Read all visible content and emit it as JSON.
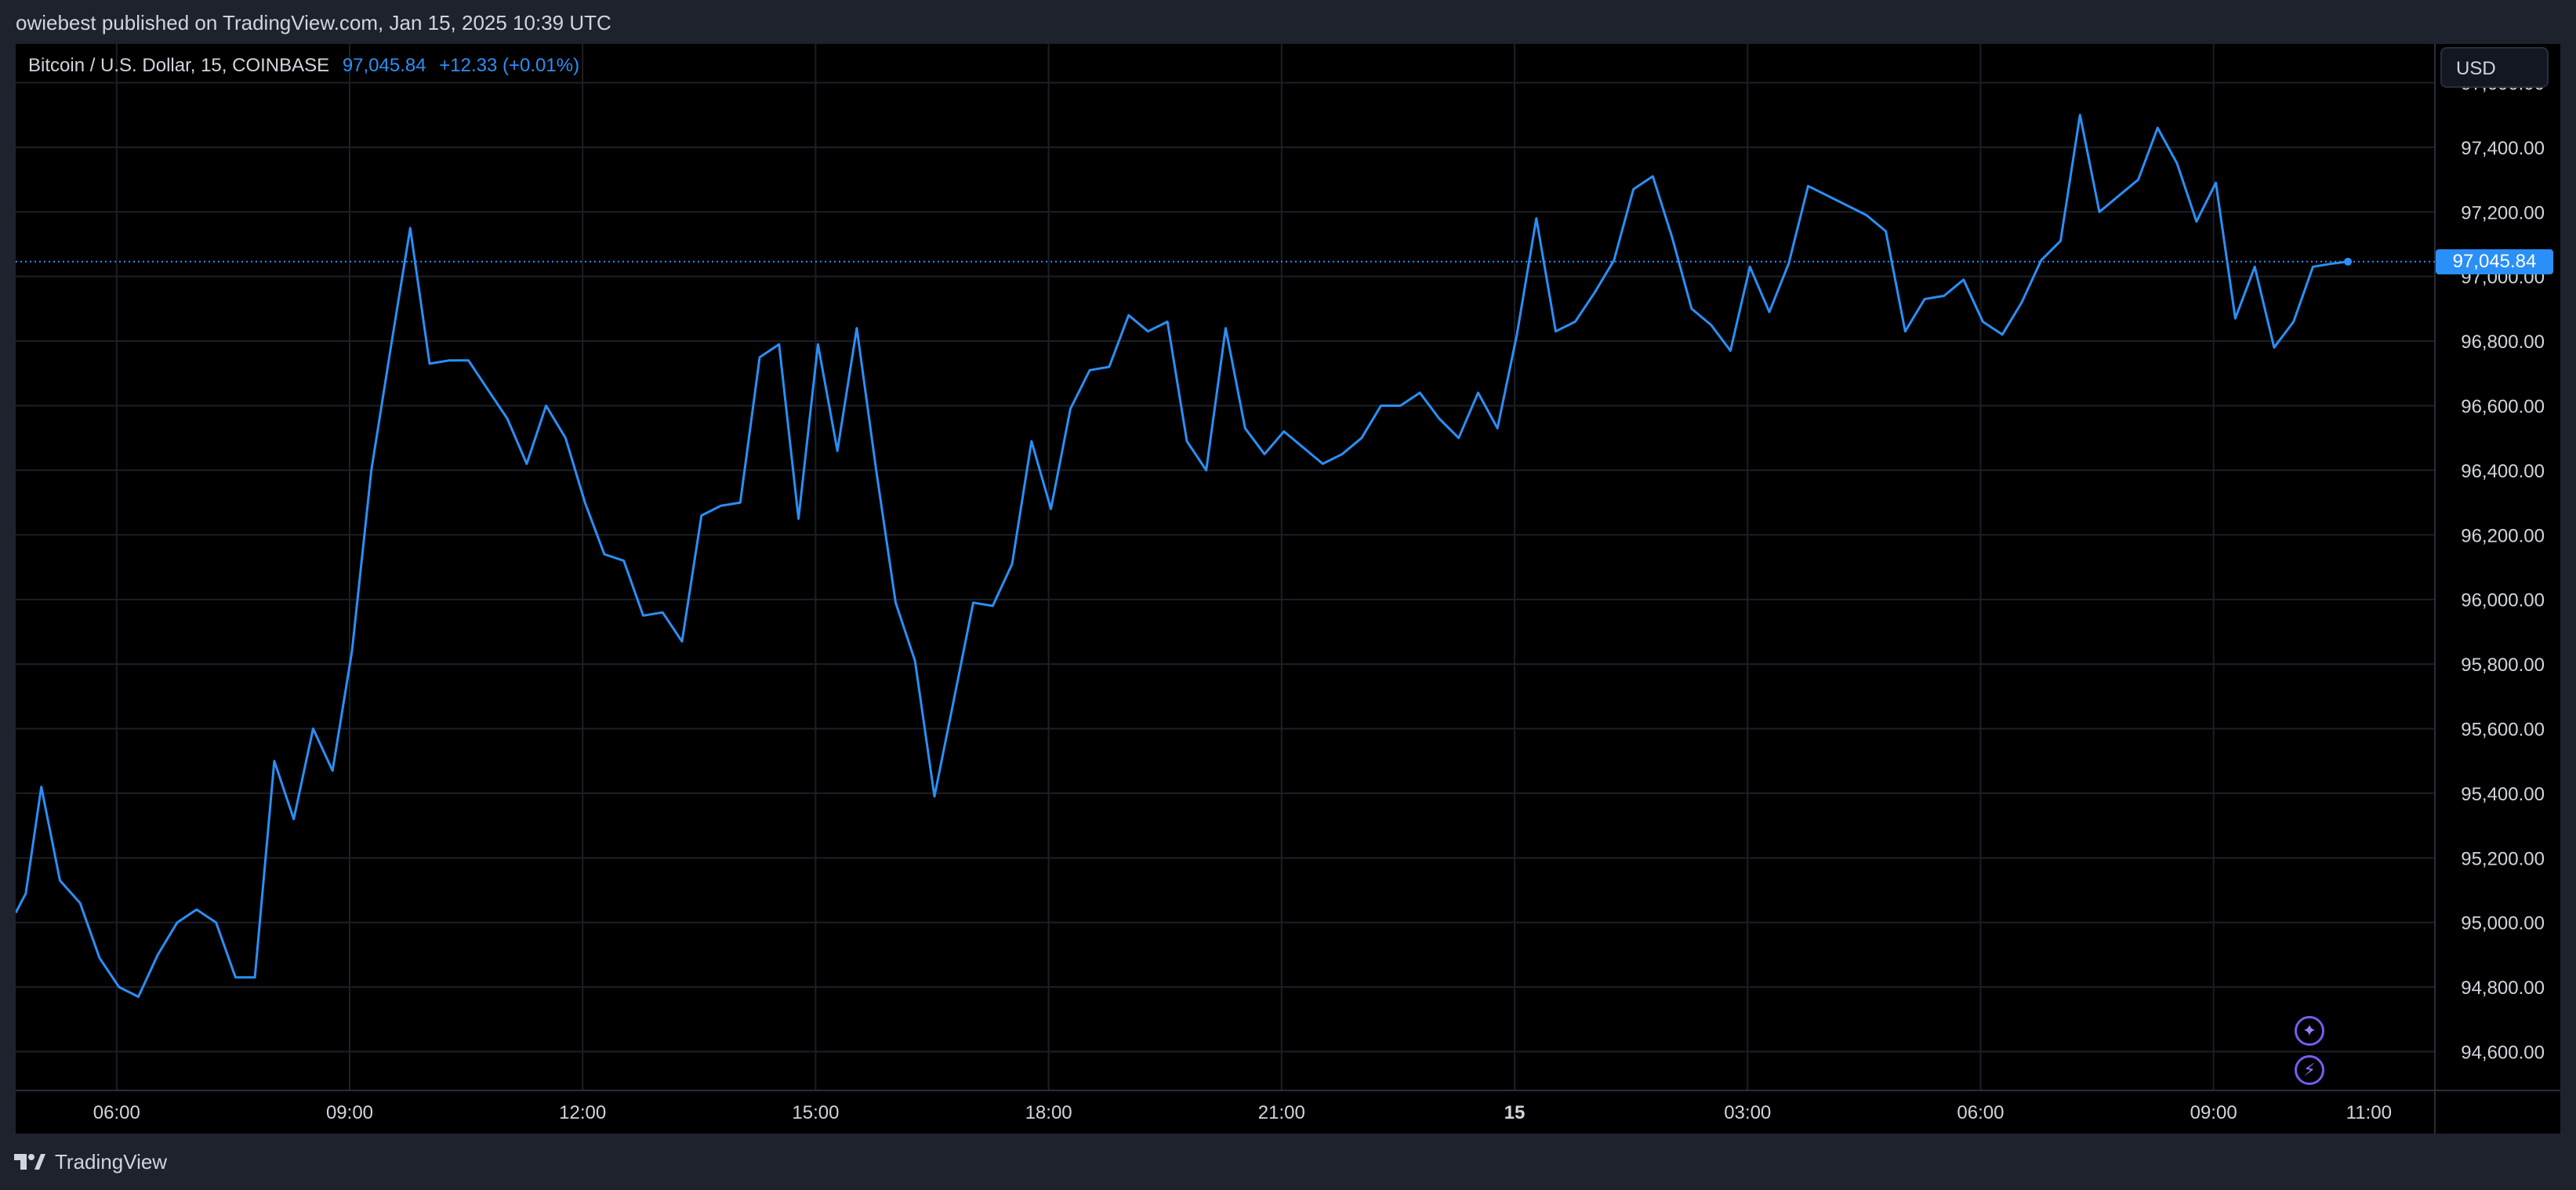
{
  "header": {
    "publisher_text": "owiebest published on TradingView.com, Jan 15, 2025 10:39 UTC"
  },
  "legend": {
    "symbol": "Bitcoin / U.S. Dollar, 15, COINBASE",
    "price": "97,045.84",
    "change": "+12.33 (+0.01%)"
  },
  "currency_button": {
    "label": "USD"
  },
  "last_price_badge": "97,045.84",
  "footer": {
    "logo_text": "TradingView"
  },
  "colors": {
    "line": "#2a8ff7",
    "background": "#000000",
    "grid": "#1c1f26",
    "axis_text": "#d1d4dc",
    "badge": "#2a8ff7"
  },
  "icons": {
    "spark": "sparkle-icon",
    "lightning": "lightning-icon",
    "logo": "tradingview-logo-icon"
  },
  "chart_data": {
    "type": "line",
    "ylim": [
      94480,
      97720
    ],
    "y_ticks": [
      94600,
      94800,
      95000,
      95200,
      95400,
      95600,
      95800,
      96000,
      96200,
      96400,
      96600,
      96800,
      97000,
      97200,
      97400,
      97600
    ],
    "y_tick_labels": [
      "94,600.00",
      "94,800.00",
      "95,000.00",
      "95,200.00",
      "95,400.00",
      "95,600.00",
      "95,800.00",
      "96,000.00",
      "96,200.00",
      "96,400.00",
      "96,600.00",
      "96,800.00",
      "97,000.00",
      "97,200.00",
      "97,400.00",
      "97,600.00"
    ],
    "x_tick_labels": [
      "06:00",
      "09:00",
      "12:00",
      "15:00",
      "18:00",
      "21:00",
      "15",
      "03:00",
      "06:00",
      "09:00",
      "11:00"
    ],
    "x_tick_hours": [
      6,
      9,
      12,
      15,
      18,
      21,
      24,
      27,
      30,
      33,
      35
    ],
    "x_range_hours": [
      4.7,
      35.85
    ],
    "last_value": 97045.84,
    "series": [
      {
        "hours": [
          4.7,
          4.83,
          5.03,
          5.27,
          5.53,
          5.78,
          6.03,
          6.28,
          6.53,
          6.78,
          7.03,
          7.28,
          7.53,
          7.78,
          8.03,
          8.28,
          8.53,
          8.78,
          9.03,
          9.28,
          9.53,
          9.78,
          10.03,
          10.28,
          10.53,
          10.78,
          11.03,
          11.28,
          11.53,
          11.78,
          12.03,
          12.28,
          12.53,
          12.78,
          13.03,
          13.28,
          13.53,
          13.78,
          14.03,
          14.28,
          14.53,
          14.78,
          15.03,
          15.28,
          15.53,
          15.78,
          16.03,
          16.28,
          16.53,
          16.78,
          17.03,
          17.28,
          17.53,
          17.78,
          18.03,
          18.28,
          18.53,
          18.78,
          19.03,
          19.28,
          19.53,
          19.78,
          20.03,
          20.28,
          20.53,
          20.78,
          21.03,
          21.28,
          21.53,
          21.78,
          22.03,
          22.28,
          22.53,
          22.78,
          23.03,
          23.28,
          23.53,
          23.78,
          24.03,
          24.28,
          24.53,
          24.78,
          25.03,
          25.28,
          25.53,
          25.78,
          26.03,
          26.28,
          26.53,
          26.78,
          27.03,
          27.28,
          27.53,
          27.78,
          28.03,
          28.28,
          28.53,
          28.78,
          29.03,
          29.28,
          29.53,
          29.78,
          30.03,
          30.28,
          30.53,
          30.78,
          31.03,
          31.28,
          31.53,
          31.78,
          32.03,
          32.28,
          32.53,
          32.78,
          33.03,
          33.28,
          33.53,
          33.78,
          34.03,
          34.28,
          34.53,
          34.73
        ],
        "values": [
          95030,
          95090,
          95420,
          95130,
          95060,
          94890,
          94800,
          94770,
          94900,
          95000,
          95040,
          95000,
          94830,
          94830,
          95500,
          95320,
          95600,
          95470,
          95840,
          96400,
          96780,
          97150,
          96730,
          96740,
          96740,
          96650,
          96560,
          96420,
          96600,
          96500,
          96300,
          96140,
          96120,
          95950,
          95960,
          95870,
          96260,
          96290,
          96300,
          96750,
          96790,
          96250,
          96790,
          96460,
          96840,
          96400,
          95990,
          95810,
          95390,
          95690,
          95990,
          95980,
          96110,
          96490,
          96280,
          96590,
          96710,
          96720,
          96880,
          96830,
          96860,
          96490,
          96400,
          96840,
          96530,
          96450,
          96520,
          96470,
          96420,
          96450,
          96500,
          96600,
          96600,
          96640,
          96560,
          96500,
          96640,
          96530,
          96820,
          97180,
          96830,
          96860,
          96950,
          97050,
          97270,
          97310,
          97120,
          96900,
          96850,
          96770,
          97030,
          96890,
          97040,
          97280,
          97250,
          97220,
          97190,
          97140,
          96830,
          96930,
          96940,
          96990,
          96860,
          96820,
          96920,
          97050,
          97110,
          97500,
          97200,
          97250,
          97300,
          97460,
          97350,
          97170,
          97290,
          96870,
          97030,
          96780,
          96860,
          97030,
          97040,
          97046
        ]
      }
    ]
  }
}
